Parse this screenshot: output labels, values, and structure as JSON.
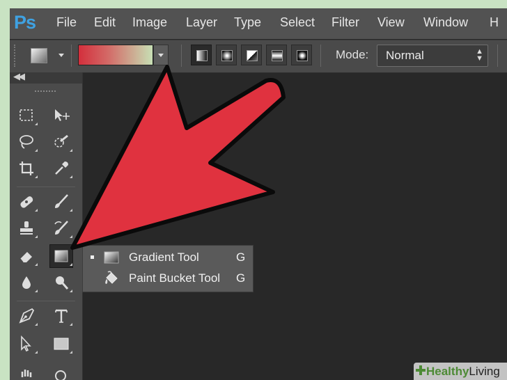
{
  "menubar": {
    "logo": "Ps",
    "items": [
      "File",
      "Edit",
      "Image",
      "Layer",
      "Type",
      "Select",
      "Filter",
      "View",
      "Window",
      "H"
    ]
  },
  "options_bar": {
    "mode_label": "Mode:",
    "mode_value": "Normal",
    "gradient_preview_colors": [
      "#d32f3c",
      "#c7dfb4"
    ],
    "gradient_types": [
      "linear-gradient-icon",
      "radial-gradient-icon",
      "angle-gradient-icon",
      "reflected-gradient-icon",
      "diamond-gradient-icon"
    ],
    "selected_gradient_type": "linear-gradient-icon"
  },
  "toolbar": {
    "selected_tool": "gradient-tool-icon"
  },
  "flyout": {
    "items": [
      {
        "label": "Gradient Tool",
        "shortcut": "G",
        "icon": "gradient-tool-icon",
        "active": true
      },
      {
        "label": "Paint Bucket Tool",
        "shortcut": "G",
        "icon": "paint-bucket-icon",
        "active": false
      }
    ]
  },
  "annotation": {
    "arrow_color": "#e0323f"
  },
  "watermark": {
    "brand": "Healthy",
    "suffix": "Living"
  },
  "colors": {
    "ps_blue": "#3fa2e2",
    "menubar": "#525252",
    "canvas": "#282828",
    "frame": "#c9e3c3"
  }
}
